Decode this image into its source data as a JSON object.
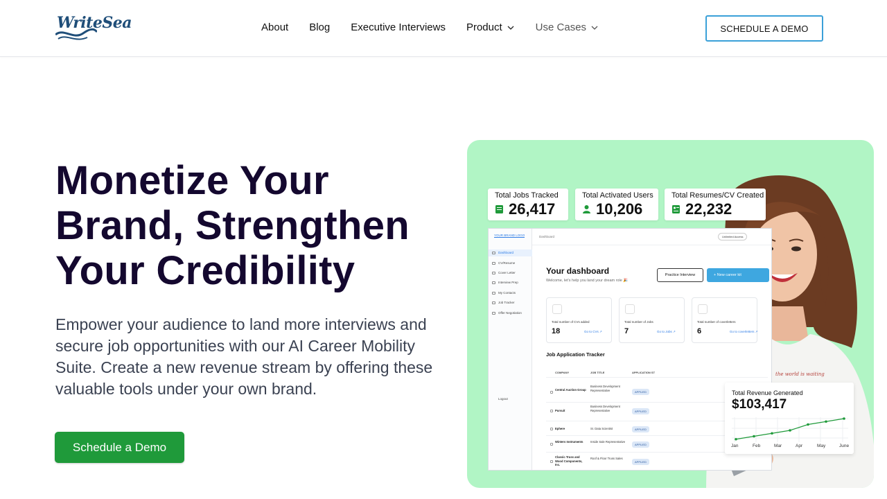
{
  "header": {
    "logo_text": "WriteSea",
    "nav": [
      {
        "label": "About"
      },
      {
        "label": "Blog"
      },
      {
        "label": "Executive Interviews"
      },
      {
        "label": "Product"
      },
      {
        "label": "Use Cases"
      }
    ],
    "demo_button": "SCHEDULE A DEMO"
  },
  "hero": {
    "title_lines": [
      "Monetize Your",
      "Brand, Strengthen",
      "Your Credibility"
    ],
    "subtitle": "Empower your audience to land more interviews and secure job opportunities with our AI Career Mobility Suite. Create a new revenue stream by offering these valuable tools under your own brand.",
    "cta": "Schedule a Demo"
  },
  "stats": [
    {
      "label": "Total Jobs Tracked",
      "value": "26,417"
    },
    {
      "label": "Total Activated Users",
      "value": "10,206"
    },
    {
      "label": "Total Resumes/CV Created",
      "value": "22,232"
    }
  ],
  "dashboard": {
    "side_logo": "YOUR BRAND LOGO",
    "side_items": [
      "Dashboard",
      "CV/Resume",
      "Cover Letter",
      "Interview Prep",
      "My Contacts",
      "Job Tracker",
      "Offer Negotiation"
    ],
    "logout": "Logout",
    "crumb": "Dashboard",
    "license": "Unlimited Access",
    "heading": "Your dashboard",
    "subheading": "Welcome, let's help you land your dream role 🎉",
    "practice_btn": "Practice Interview",
    "new_btn": "+ New career kit",
    "cards": [
      {
        "label": "Total number of CVs added",
        "value": "18",
        "link": "Go to CVs ↗"
      },
      {
        "label": "Total number of Jobs",
        "value": "7",
        "link": "Go to Jobs ↗"
      },
      {
        "label": "Total number of coverletters",
        "value": "6",
        "link": "Go to coverletters ↗"
      }
    ],
    "tracker_heading": "Job Application Tracker",
    "columns": [
      "COMPANY",
      "JOB TITLE",
      "APPLICATION ST"
    ],
    "rows": [
      {
        "company": "Central Auction Group",
        "job": "Business Development Representative",
        "status": "APPLIED"
      },
      {
        "company": "Pursuit",
        "job": "Business Development Representative",
        "status": "APPLIED"
      },
      {
        "company": "Ephere",
        "job": "Sr. Data Scientist",
        "status": "APPLIED"
      },
      {
        "company": "Winters Instruments",
        "job": "Inside Sale Representative",
        "status": "APPLIED"
      },
      {
        "company": "Classic Truss and Wood Components, Inc.",
        "job": "Roof & Floor Truss Sales",
        "status": "APPLIED"
      }
    ]
  },
  "revenue": {
    "label": "Total Revenue Generated",
    "value": "$103,417",
    "months": [
      "Jan",
      "Feb",
      "Mar",
      "Apr",
      "May",
      "June"
    ],
    "points": [
      1,
      2,
      3,
      4,
      6,
      7,
      8
    ]
  },
  "colors": {
    "accent_green": "#1f9a3a",
    "card_bg": "#b1f5c5",
    "outline_blue": "#3aa0d8",
    "title": "#14082f"
  }
}
